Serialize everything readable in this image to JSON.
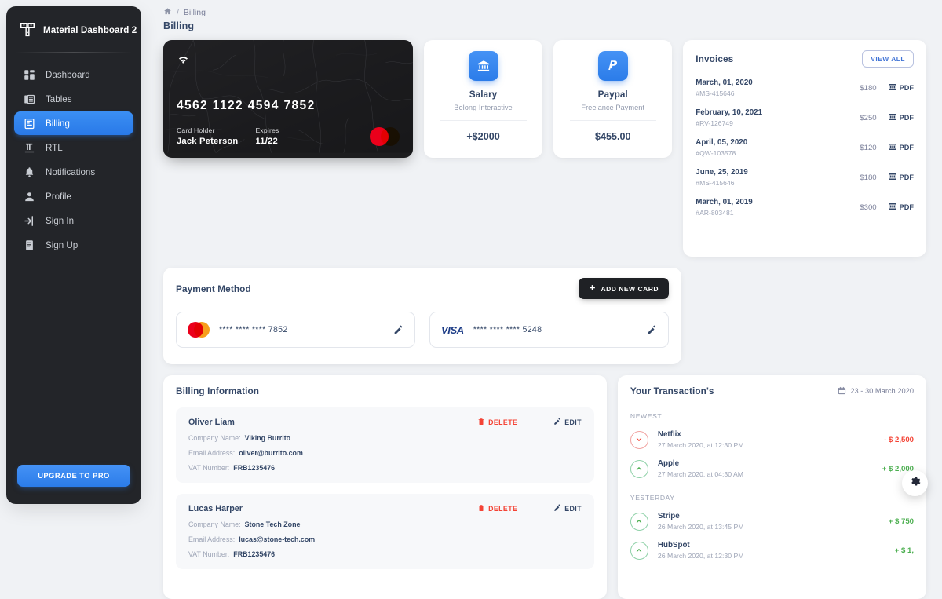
{
  "sidebar": {
    "brand": "Material Dashboard 2",
    "brand_icon": "dashboard-logo-icon",
    "items": [
      {
        "label": "Dashboard",
        "icon": "dashboard-icon",
        "active": false
      },
      {
        "label": "Tables",
        "icon": "tables-icon",
        "active": false
      },
      {
        "label": "Billing",
        "icon": "billing-icon",
        "active": true
      },
      {
        "label": "RTL",
        "icon": "rtl-icon",
        "active": false
      },
      {
        "label": "Notifications",
        "icon": "bell-icon",
        "active": false
      },
      {
        "label": "Profile",
        "icon": "person-icon",
        "active": false
      },
      {
        "label": "Sign In",
        "icon": "sign-in-icon",
        "active": false
      },
      {
        "label": "Sign Up",
        "icon": "sign-up-icon",
        "active": false
      }
    ],
    "upgrade_label": "UPGRADE TO PRO"
  },
  "header": {
    "breadcrumb_home_icon": "home-icon",
    "breadcrumb_sep": "/",
    "breadcrumb_current": "Billing",
    "page_title": "Billing"
  },
  "credit_card": {
    "contactless_icon": "contactless-wifi-icon",
    "number": "4562  1122  4594  7852",
    "holder_label": "Card Holder",
    "holder_value": "Jack Peterson",
    "expires_label": "Expires",
    "expires_value": "11/22",
    "brand_icon": "mastercard-icon"
  },
  "mini_cards": [
    {
      "icon": "bank-icon",
      "title": "Salary",
      "subtitle": "Belong Interactive",
      "amount": "+$2000"
    },
    {
      "icon": "paypal-icon",
      "title": "Paypal",
      "subtitle": "Freelance Payment",
      "amount": "$455.00"
    }
  ],
  "invoices": {
    "title": "Invoices",
    "view_all_label": "VIEW ALL",
    "pdf_label": "PDF",
    "pdf_icon": "pdf-icon",
    "rows": [
      {
        "date": "March, 01, 2020",
        "id": "#MS-415646",
        "amount": "$180"
      },
      {
        "date": "February, 10, 2021",
        "id": "#RV-126749",
        "amount": "$250"
      },
      {
        "date": "April, 05, 2020",
        "id": "#QW-103578",
        "amount": "$120"
      },
      {
        "date": "June, 25, 2019",
        "id": "#MS-415646",
        "amount": "$180"
      },
      {
        "date": "March, 01, 2019",
        "id": "#AR-803481",
        "amount": "$300"
      }
    ]
  },
  "payment_method": {
    "title": "Payment Method",
    "add_label": "ADD NEW CARD",
    "add_icon": "plus-icon",
    "cards": [
      {
        "brand": "mastercard",
        "brand_text": "",
        "number": "****  ****  ****  7852",
        "edit_icon": "pencil-icon"
      },
      {
        "brand": "visa",
        "brand_text": "VISA",
        "number": "****  ****  ****  5248",
        "edit_icon": "pencil-icon"
      }
    ]
  },
  "billing_information": {
    "title": "Billing Information",
    "delete_label": "DELETE",
    "edit_label": "EDIT",
    "delete_icon": "trash-icon",
    "edit_icon": "pencil-icon",
    "entries": [
      {
        "name": "Oliver Liam",
        "company_label": "Company Name:",
        "company_value": "Viking Burrito",
        "email_label": "Email Address:",
        "email_value": "oliver@burrito.com",
        "vat_label": "VAT Number:",
        "vat_value": "FRB1235476"
      },
      {
        "name": "Lucas Harper",
        "company_label": "Company Name:",
        "company_value": "Stone Tech Zone",
        "email_label": "Email Address:",
        "email_value": "lucas@stone-tech.com",
        "vat_label": "VAT Number:",
        "vat_value": "FRB1235476"
      }
    ]
  },
  "transactions": {
    "title": "Your Transaction's",
    "date_range": "23 - 30 March 2020",
    "calendar_icon": "calendar-icon",
    "groups": [
      {
        "label": "NEWEST",
        "rows": [
          {
            "name": "Netflix",
            "time": "27 March 2020, at 12:30 PM",
            "amount": "- $ 2,500",
            "direction": "down"
          },
          {
            "name": "Apple",
            "time": "27 March 2020, at 04:30 AM",
            "amount": "+ $ 2,000",
            "direction": "up"
          }
        ]
      },
      {
        "label": "YESTERDAY",
        "rows": [
          {
            "name": "Stripe",
            "time": "26 March 2020, at 13:45 PM",
            "amount": "+ $ 750",
            "direction": "up"
          },
          {
            "name": "HubSpot",
            "time": "26 March 2020, at 12:30 PM",
            "amount": "+ $ 1,",
            "direction": "up"
          }
        ]
      }
    ]
  },
  "fab": {
    "icon": "gear-icon"
  },
  "colors": {
    "accent": "#2b7ce9",
    "sidebar_bg": "#232529",
    "page_bg": "#f0f2f5",
    "text": "#344767",
    "muted": "#9da4b6",
    "positive": "#4caf50",
    "negative": "#f44335"
  }
}
